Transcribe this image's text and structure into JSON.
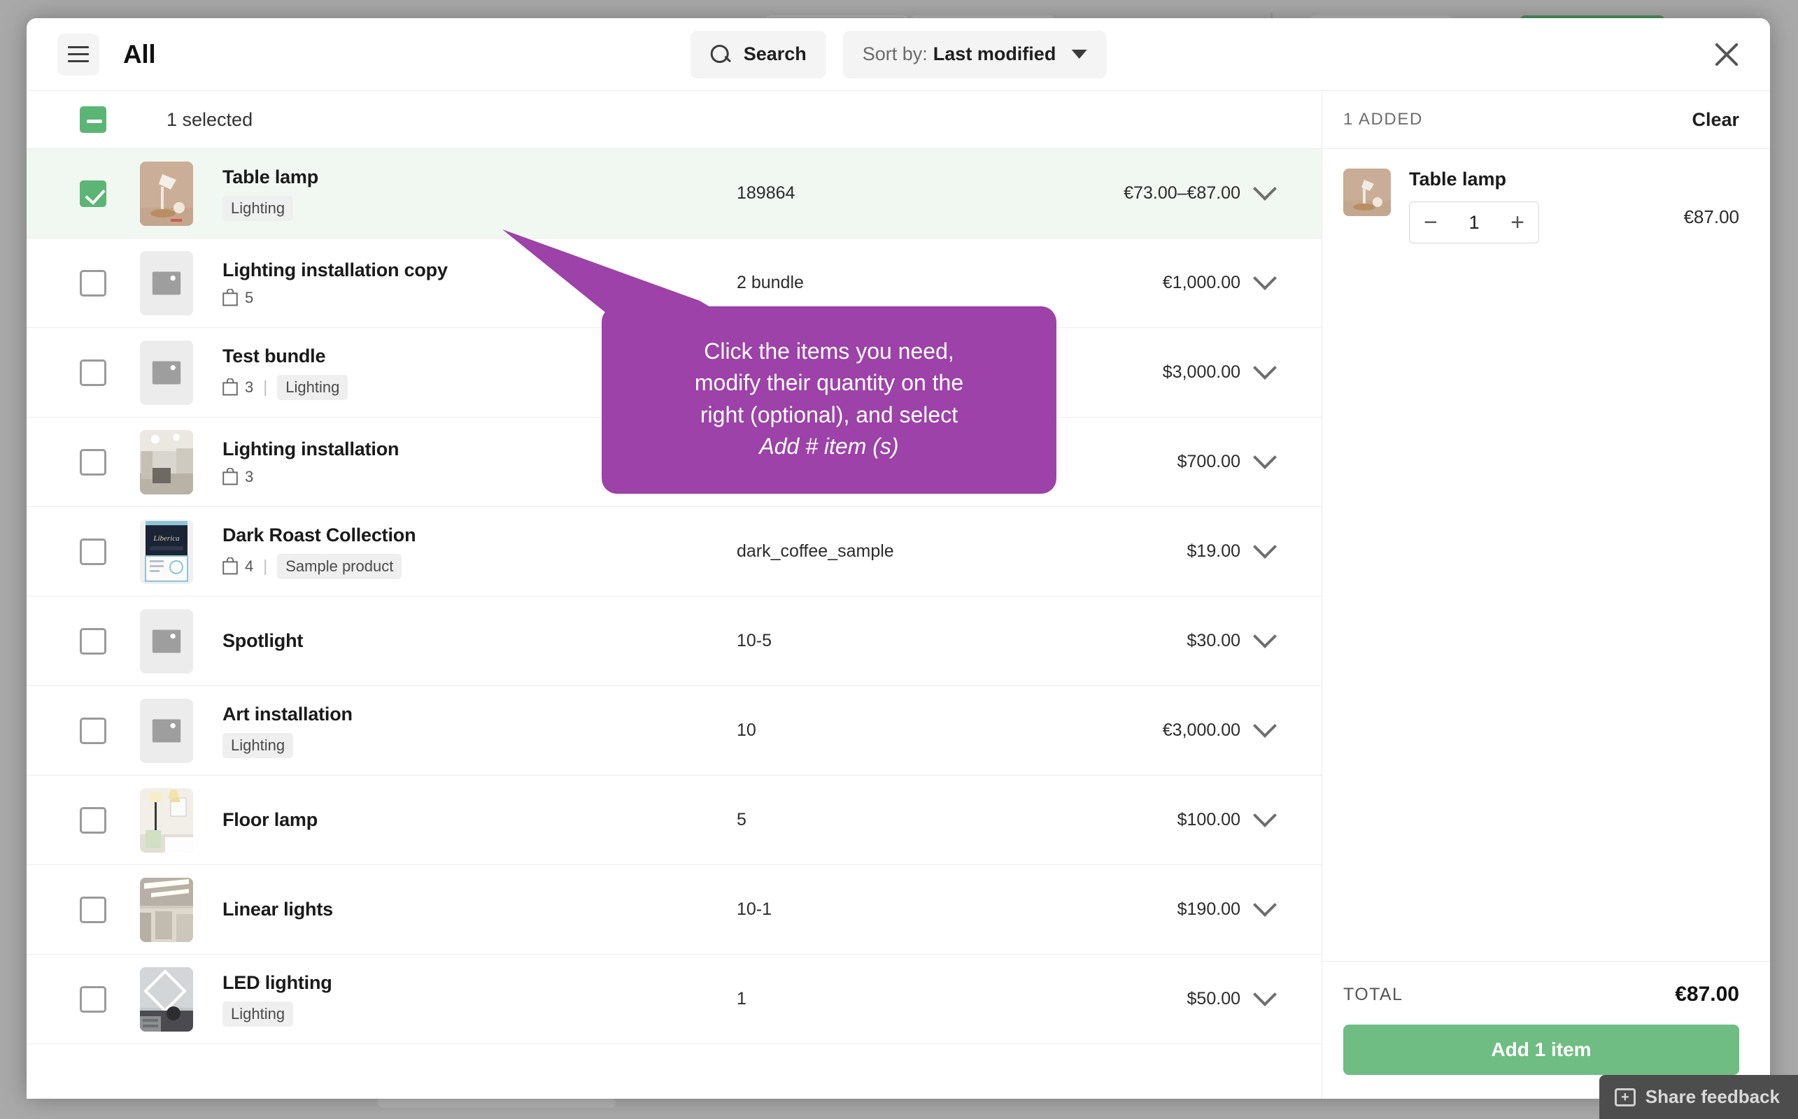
{
  "header": {
    "title": "All",
    "menu_icon": "hamburger-icon",
    "search_label": "Search",
    "search_icon": "search-icon",
    "sort_prefix": "Sort by:",
    "sort_value": "Last modified",
    "sort_caret_icon": "chevron-down-icon",
    "close_icon": "close-icon"
  },
  "list": {
    "select_all_state": "indeterminate",
    "selected_label": "1 selected",
    "items": [
      {
        "name": "Table lamp",
        "tags": [
          "Lighting"
        ],
        "bag_count": null,
        "sku": "189864",
        "price": "€73.00–€87.00",
        "selected": true,
        "thumb": "photo-lamp"
      },
      {
        "name": "Lighting installation copy",
        "tags": [],
        "bag_count": "5",
        "sku": "2 bundle",
        "price": "€1,000.00",
        "selected": false,
        "thumb": "placeholder"
      },
      {
        "name": "Test bundle",
        "tags": [
          "Lighting"
        ],
        "bag_count": "3",
        "sku": "",
        "price": "$3,000.00",
        "selected": false,
        "thumb": "placeholder"
      },
      {
        "name": "Lighting installation",
        "tags": [],
        "bag_count": "3",
        "sku": "",
        "price": "$700.00",
        "selected": false,
        "thumb": "photo-office"
      },
      {
        "name": "Dark Roast Collection",
        "tags": [
          "Sample product"
        ],
        "bag_count": "4",
        "sku": "dark_coffee_sample",
        "price": "$19.00",
        "selected": false,
        "thumb": "photo-coffee"
      },
      {
        "name": "Spotlight",
        "tags": [],
        "bag_count": null,
        "sku": "10-5",
        "price": "$30.00",
        "selected": false,
        "thumb": "placeholder"
      },
      {
        "name": "Art installation",
        "tags": [
          "Lighting"
        ],
        "bag_count": null,
        "sku": "10",
        "price": "€3,000.00",
        "selected": false,
        "thumb": "placeholder"
      },
      {
        "name": "Floor lamp",
        "tags": [],
        "bag_count": null,
        "sku": "5",
        "price": "$100.00",
        "selected": false,
        "thumb": "photo-floorlamp"
      },
      {
        "name": "Linear lights",
        "tags": [],
        "bag_count": null,
        "sku": "10-1",
        "price": "$190.00",
        "selected": false,
        "thumb": "photo-linear"
      },
      {
        "name": "LED lighting",
        "tags": [
          "Lighting"
        ],
        "bag_count": null,
        "sku": "1",
        "price": "$50.00",
        "selected": false,
        "thumb": "photo-led"
      }
    ]
  },
  "cart": {
    "added_label": "1 ADDED",
    "clear_label": "Clear",
    "items": [
      {
        "name": "Table lamp",
        "quantity": "1",
        "price": "€87.00",
        "minus_icon": "minus-icon",
        "plus_icon": "plus-icon"
      }
    ],
    "total_label": "TOTAL",
    "total_value": "€87.00",
    "add_button_label": "Add 1 item"
  },
  "callout": {
    "line1": "Click the items you need,",
    "line2": "modify their quantity on the",
    "line3": "right (optional), and select",
    "emphasis": "Add # item (s)",
    "color": "#9c42a8"
  },
  "share_feedback": {
    "label": "Share feedback",
    "icon": "feedback-plus-icon"
  },
  "colors": {
    "accent_green": "#5bb575",
    "button_green": "#6fbd83",
    "callout_purple": "#9c42a8",
    "selected_row": "#f1f8f1"
  }
}
